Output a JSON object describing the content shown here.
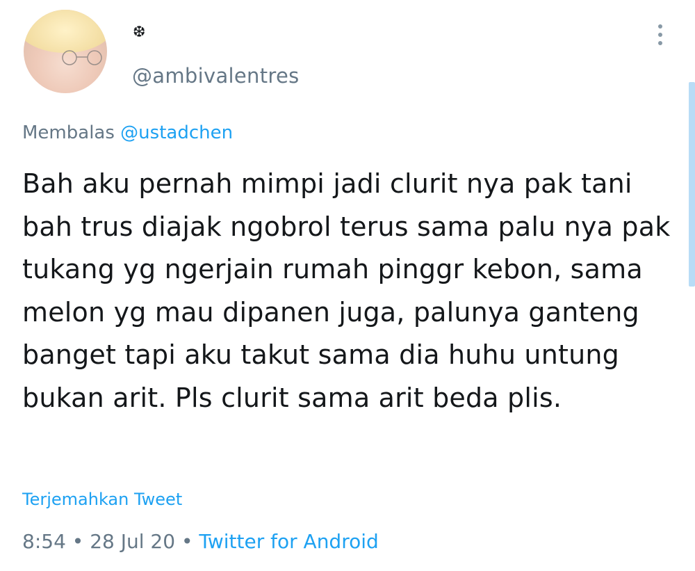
{
  "author": {
    "display_name": "❆",
    "handle": "@ambivalentres",
    "avatar_icon": "anime-avatar"
  },
  "reply": {
    "prefix": "Membalas ",
    "mention": "@ustadchen"
  },
  "tweet": {
    "text": "Bah aku pernah mimpi jadi clurit nya pak tani bah trus diajak ngobrol terus sama palu nya pak tukang yg ngerjain rumah pinggr kebon, sama melon yg mau dipanen juga, palunya ganteng banget tapi aku takut sama dia huhu untung bukan arit. Pls clurit sama arit beda plis.",
    "translate_label": "Terjemahkan Tweet"
  },
  "meta": {
    "time": "8:54",
    "separator": " • ",
    "date": "28 Jul 20",
    "source": "Twitter for Android"
  },
  "colors": {
    "link": "#1da1f2",
    "secondary": "#657786",
    "text": "#14171a"
  }
}
